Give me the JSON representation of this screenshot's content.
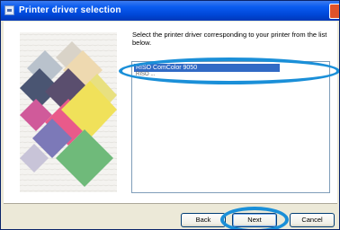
{
  "window": {
    "title": "Printer driver selection"
  },
  "instructions": "Select the printer driver corresponding to your printer from the list below.",
  "driver_list": {
    "items": [
      {
        "label": "RISO ComColor 9050",
        "selected": true
      },
      {
        "label": "RISO ...",
        "selected": false
      }
    ]
  },
  "buttons": {
    "back": "Back",
    "next": "Next",
    "cancel": "Cancel"
  },
  "colors": {
    "title_bar": "#0a5cf0",
    "highlight_ring": "#1a8fd8",
    "selection": "#316ac5"
  }
}
